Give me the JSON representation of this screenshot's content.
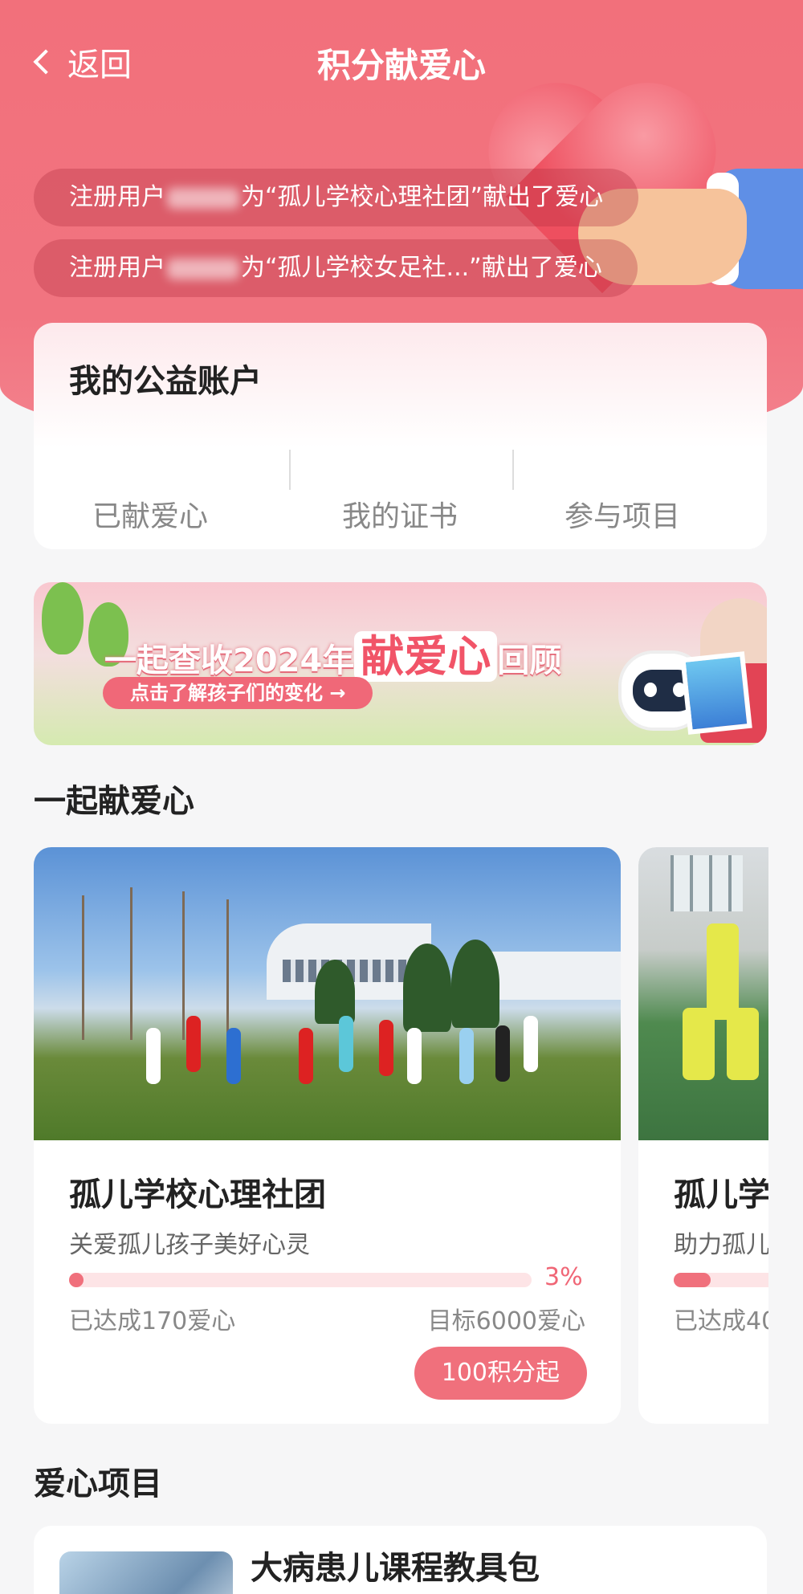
{
  "nav": {
    "back_label": "返回",
    "title": "积分献爱心"
  },
  "ticker": [
    {
      "prefix": "注册用户",
      "suffix": "为“孤儿学校心理社团”献出了爱心"
    },
    {
      "prefix": "注册用户",
      "suffix": "为“孤儿学校女足社...”献出了爱心"
    }
  ],
  "account": {
    "title": "我的公益账户",
    "stats": [
      {
        "label": "已献爱心"
      },
      {
        "label": "我的证书"
      },
      {
        "label": "参与项目"
      }
    ]
  },
  "banner": {
    "headline_pre": "一起查收2024年",
    "headline_em": "献爱心",
    "headline_post": "回顾",
    "cta": "点击了解孩子们的变化 →"
  },
  "sections": {
    "together": "一起献爱心",
    "projects": "爱心项目"
  },
  "carousel": [
    {
      "title": "孤儿学校心理社团",
      "subtitle": "关爱孤儿孩子美好心灵",
      "progress_pct": 3,
      "progress_label": "3%",
      "reached": "已达成170爱心",
      "goal": "目标6000爱心",
      "button": "100积分起"
    },
    {
      "title": "孤儿学",
      "subtitle": "助力孤儿",
      "progress_pct": 8,
      "reached": "已达成40"
    }
  ],
  "project_list": [
    {
      "title": "大病患儿课程教具包"
    }
  ],
  "colors": {
    "primary": "#f0707c",
    "header_bg": "#f2707b"
  }
}
